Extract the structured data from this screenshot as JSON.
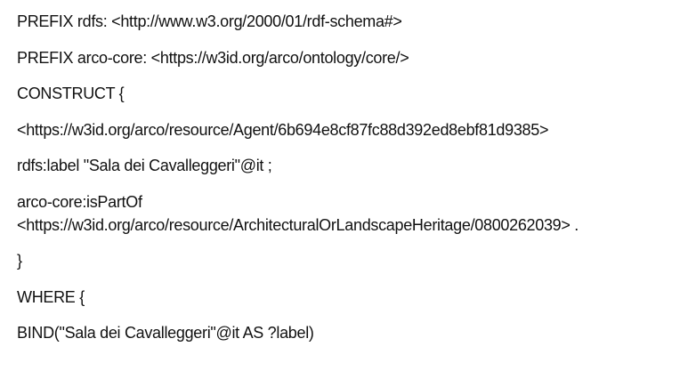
{
  "document": {
    "lines": [
      "PREFIX rdfs: <http://www.w3.org/2000/01/rdf-schema#>",
      "PREFIX arco-core: <https://w3id.org/arco/ontology/core/>",
      "CONSTRUCT {",
      "<https://w3id.org/arco/resource/Agent/6b694e8cf87fc88d392ed8ebf81d9385>",
      "rdfs:label \"Sala dei Cavalleggeri\"@it ;",
      "arco-core:isPartOf",
      "<https://w3id.org/arco/resource/ArchitecturalOrLandscapeHeritage/0800262039> .",
      "}",
      "WHERE {",
      "BIND(\"Sala dei Cavalleggeri\"@it AS ?label)"
    ]
  }
}
